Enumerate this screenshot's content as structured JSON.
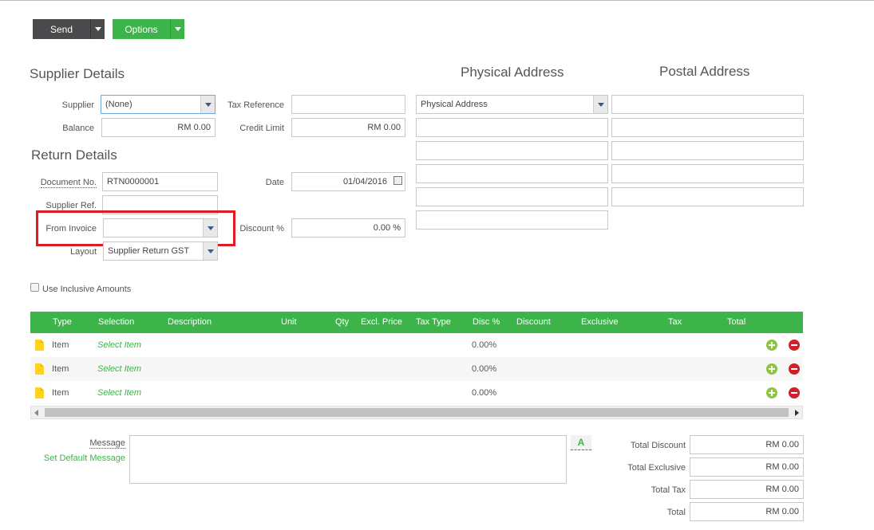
{
  "toolbar": {
    "send_label": "Send",
    "options_label": "Options"
  },
  "supplier_details": {
    "heading": "Supplier Details",
    "supplier_label": "Supplier",
    "supplier_value": "(None)",
    "balance_label": "Balance",
    "balance_value": "RM 0.00",
    "tax_reference_label": "Tax Reference",
    "tax_reference_value": "",
    "credit_limit_label": "Credit Limit",
    "credit_limit_value": "RM 0.00"
  },
  "return_details": {
    "heading": "Return Details",
    "document_no_label": "Document No.",
    "document_no_value": "RTN0000001",
    "supplier_ref_label": "Supplier Ref.",
    "supplier_ref_value": "",
    "from_invoice_label": "From Invoice",
    "from_invoice_value": "",
    "layout_label": "Layout",
    "layout_value": "Supplier Return GST",
    "date_label": "Date",
    "date_value": "01/04/2016",
    "discount_label": "Discount %",
    "discount_value": "0.00 %"
  },
  "physical_address": {
    "heading": "Physical Address",
    "selector_value": "Physical Address"
  },
  "postal_address": {
    "heading": "Postal Address"
  },
  "inclusive_label": "Use Inclusive Amounts",
  "grid": {
    "columns": [
      "Type",
      "Selection",
      "Description",
      "Unit",
      "Qty",
      "Excl. Price",
      "Tax Type",
      "Disc %",
      "Discount",
      "Exclusive",
      "Tax",
      "Total"
    ],
    "rows": [
      {
        "type": "Item",
        "selection": "Select Item",
        "disc": "0.00%"
      },
      {
        "type": "Item",
        "selection": "Select Item",
        "disc": "0.00%"
      },
      {
        "type": "Item",
        "selection": "Select Item",
        "disc": "0.00%"
      }
    ]
  },
  "message": {
    "label": "Message",
    "default_link": "Set Default Message",
    "format_icon": "A"
  },
  "totals": {
    "total_discount_label": "Total Discount",
    "total_discount_value": "RM 0.00",
    "total_exclusive_label": "Total Exclusive",
    "total_exclusive_value": "RM 0.00",
    "total_tax_label": "Total Tax",
    "total_tax_value": "RM 0.00",
    "total_label": "Total",
    "total_value": "RM 0.00"
  },
  "colors": {
    "accent_green": "#3cb44a",
    "dark_button": "#4a4a4d",
    "highlight_red": "#dd1c24"
  }
}
